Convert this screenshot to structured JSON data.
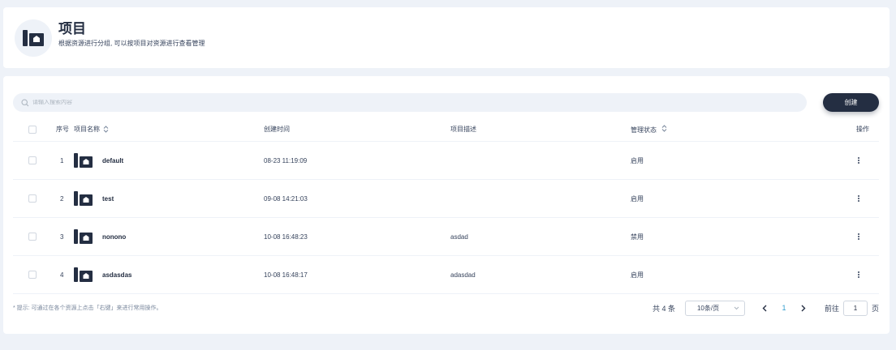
{
  "header": {
    "title": "项目",
    "description": "根据资源进行分组, 可以按项目对资源进行查看管理",
    "icon": "project-icon"
  },
  "toolbar": {
    "search_placeholder": "请输入搜索内容",
    "create_label": "创建"
  },
  "table": {
    "columns": {
      "index": "序号",
      "name": "项目名称",
      "created": "创建时间",
      "description": "项目描述",
      "status": "管理状态",
      "actions": "操作"
    },
    "rows": [
      {
        "index": "1",
        "name": "default",
        "created": "08-23 11:19:09",
        "description": "",
        "status": "启用"
      },
      {
        "index": "2",
        "name": "test",
        "created": "09-08 14:21:03",
        "description": "",
        "status": "启用"
      },
      {
        "index": "3",
        "name": "nonono",
        "created": "10-08 16:48:23",
        "description": "asdad",
        "status": "禁用"
      },
      {
        "index": "4",
        "name": "asdasdas",
        "created": "10-08 16:48:17",
        "description": "adasdad",
        "status": "启用"
      }
    ]
  },
  "footer": {
    "hint": "* 提示: 可通过在各个资源上点击「右键」来进行常用操作。",
    "total": "共 4 条",
    "page_size": "10条/页",
    "current_page": "1",
    "goto_prefix": "前往",
    "goto_value": "1",
    "goto_suffix": "页"
  },
  "colors": {
    "accent": "#242e42",
    "page_link": "#329dce",
    "background": "#eef2f8"
  }
}
